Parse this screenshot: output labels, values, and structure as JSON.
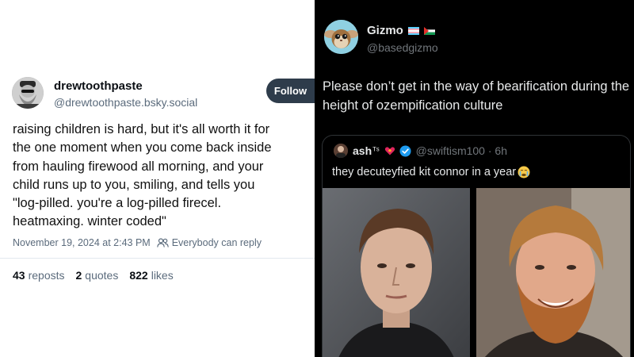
{
  "bluesky_post": {
    "author_name": "drewtoothpaste",
    "author_handle": "@drewtoothpaste.bsky.social",
    "follow_label": "Follow",
    "body": "raising children is hard, but it's all worth it for\nthe one moment when you come back inside\nfrom hauling firewood all morning, and your\nchild runs up to you, smiling, and tells you\n\"log-pilled. you're a log-pilled firecel.\nheatmaxing. winter coded\"",
    "date": "November 19, 2024 at 2:43 PM",
    "reply_setting": "Everybody can reply",
    "stats": {
      "reposts_count": "43",
      "reposts_label": "reposts",
      "quotes_count": "2",
      "quotes_label": "quotes",
      "likes_count": "822",
      "likes_label": "likes"
    },
    "colors": {
      "follow_bg": "#2e3c4b",
      "muted": "#5b6b7c"
    }
  },
  "x_post": {
    "author_name": "Gizmo",
    "author_handle": "@basedgizmo",
    "flags": [
      "transgender-flag",
      "palestine-flag"
    ],
    "body": "Please don’t get in the way of bearification during the height of ozempification culture",
    "quoted": {
      "author_name": "ash",
      "author_suffix": "ᵀˢ",
      "author_emoji": "heart-on-fire-icon",
      "verified": true,
      "handle_time": "@swiftism100 · 6h",
      "text": "they decuteyfied kit connor in a year",
      "text_emoji": "crying-face-icon",
      "images": [
        "photo-clean-shaven-man",
        "photo-bearded-smiling-man"
      ]
    },
    "colors": {
      "muted": "#71767b",
      "text": "#e7e9ea",
      "verified": "#1d9bf0"
    }
  }
}
